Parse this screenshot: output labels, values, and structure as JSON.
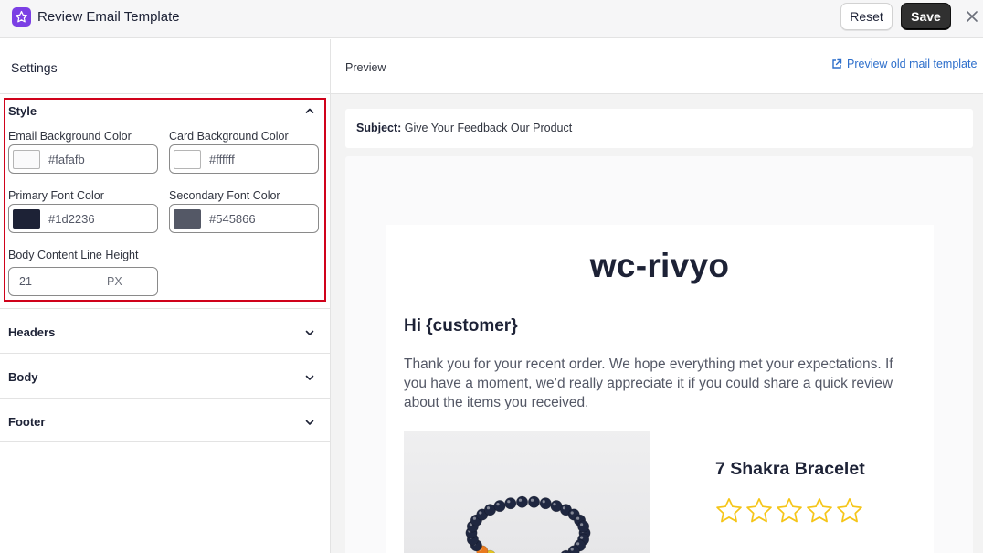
{
  "app": {
    "title": "Review Email Template",
    "reset_label": "Reset",
    "save_label": "Save",
    "logo_icon": "star-icon",
    "logo_color": "#7b3fe4"
  },
  "settings": {
    "title": "Settings",
    "style": {
      "title": "Style",
      "email_bg_label": "Email Background Color",
      "email_bg_value": "#fafafb",
      "card_bg_label": "Card Background Color",
      "card_bg_value": "#ffffff",
      "primary_font_label": "Primary Font Color",
      "primary_font_value": "#1d2236",
      "secondary_font_label": "Secondary Font Color",
      "secondary_font_value": "#545866",
      "line_height_label": "Body Content Line Height",
      "line_height_value": "21",
      "line_height_unit": "PX"
    },
    "sections": [
      {
        "title": "Headers"
      },
      {
        "title": "Body"
      },
      {
        "title": "Footer"
      }
    ]
  },
  "preview": {
    "title": "Preview",
    "old_template_link": "Preview old mail template",
    "subject_label": "Subject:",
    "subject_value": "Give Your Feedback Our Product",
    "email": {
      "brand": "wc-rivyo",
      "greeting": "Hi {customer}",
      "body": "Thank you for your recent order. We hope everything met your expectations. If you have a moment, we’d really appreciate it if you could share a quick review about the items you received.",
      "product_name": "7 Shakra Bracelet",
      "rating_max": 5,
      "rating_value": 0,
      "star_color": "#f5c518"
    }
  }
}
